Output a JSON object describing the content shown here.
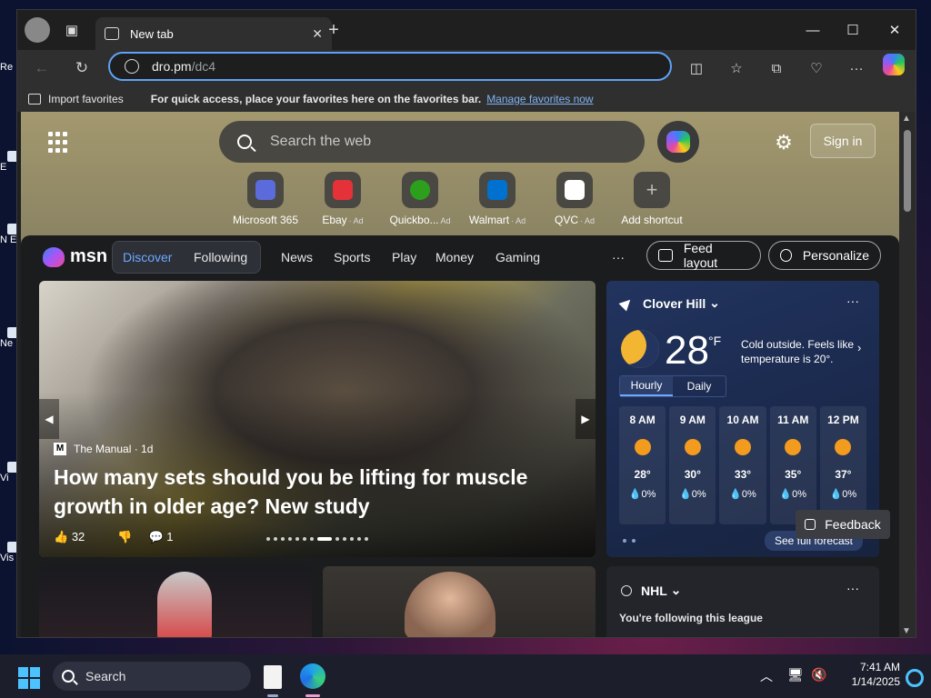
{
  "desktop": {
    "icons": [
      {
        "label": "Re"
      },
      {
        "label": "E"
      },
      {
        "label": "N E"
      },
      {
        "label": "Ne"
      },
      {
        "label": "Vi"
      },
      {
        "label": "Vis"
      }
    ]
  },
  "browser": {
    "tab_title": "New tab",
    "tab_close": "✕",
    "new_tab": "+",
    "window_controls": {
      "minimize": "—",
      "maximize": "☐",
      "close": "✕"
    },
    "address": {
      "host": "dro.pm",
      "path": "/dc4"
    },
    "favorites_bar": {
      "import_label": "Import favorites",
      "message": "For quick access, place your favorites here on the favorites bar.",
      "link": "Manage favorites now"
    }
  },
  "newtab": {
    "search_placeholder": "Search the web",
    "sign_in": "Sign in",
    "shortcuts": [
      {
        "label": "Microsoft 365",
        "ad": "",
        "color": "#5b6bdc"
      },
      {
        "label": "Ebay",
        "ad": "· Ad",
        "color": "#e53238"
      },
      {
        "label": "Quickbo...",
        "ad": "Ad",
        "color": "#2ca01c"
      },
      {
        "label": "Walmart",
        "ad": "· Ad",
        "color": "#0071ce"
      },
      {
        "label": "QVC",
        "ad": "· Ad",
        "color": "#ffffff"
      },
      {
        "label": "Add shortcut",
        "ad": "",
        "color": "#555555"
      }
    ]
  },
  "feed": {
    "brand": "msn",
    "tabs": {
      "discover": "Discover",
      "following": "Following"
    },
    "nav": [
      "News",
      "Sports",
      "Play",
      "Money",
      "Gaming"
    ],
    "more": "···",
    "feed_layout": "Feed layout",
    "personalize": "Personalize",
    "hero": {
      "source": "The Manual",
      "age": "· 1d",
      "source_initial": "M",
      "headline": "How many sets should you be lifting for muscle growth in older age? New study",
      "likes": "32",
      "comments": "1"
    },
    "weather": {
      "location": "Clover Hill",
      "temp": "28",
      "unit": "°F",
      "description": "Cold outside. Feels like temperature is 20°.",
      "tab_hourly": "Hourly",
      "tab_daily": "Daily",
      "hours": [
        {
          "time": "8 AM",
          "temp": "28°",
          "precip": "💧0%"
        },
        {
          "time": "9 AM",
          "temp": "30°",
          "precip": "💧0%"
        },
        {
          "time": "10 AM",
          "temp": "33°",
          "precip": "💧0%"
        },
        {
          "time": "11 AM",
          "temp": "35°",
          "precip": "💧0%"
        },
        {
          "time": "12 PM",
          "temp": "37°",
          "precip": "💧0%"
        }
      ],
      "forecast_link": "See full forecast"
    },
    "nhl": {
      "title": "NHL",
      "following": "You're following this league"
    },
    "feedback": "Feedback"
  },
  "taskbar": {
    "search": "Search",
    "time": "7:41 AM",
    "date": "1/14/2025"
  }
}
